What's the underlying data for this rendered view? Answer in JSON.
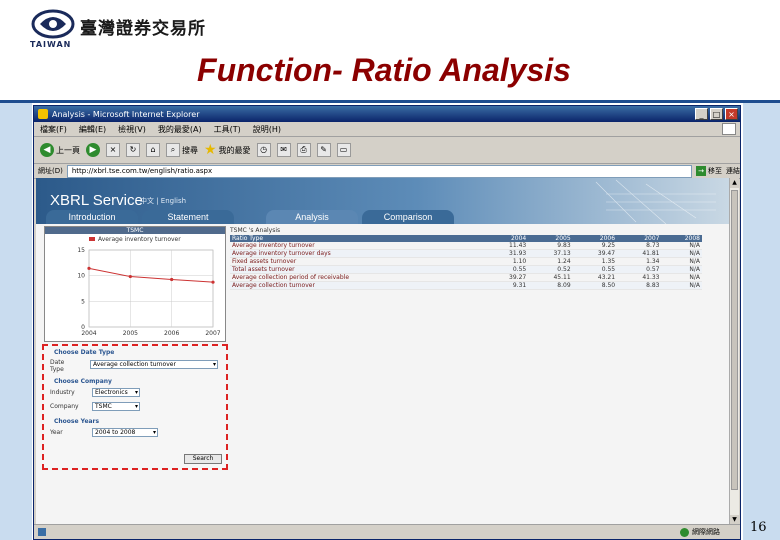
{
  "logo": {
    "org_name": "臺灣證券交易所",
    "tagline": "TAIWAN"
  },
  "slide": {
    "title": "Function- Ratio Analysis",
    "page_number": "16"
  },
  "browser": {
    "title": "Analysis - Microsoft Internet Explorer",
    "window_buttons": [
      "_",
      "□",
      "×"
    ],
    "menu": [
      "檔案(F)",
      "編輯(E)",
      "檢視(V)",
      "我的最愛(A)",
      "工具(T)",
      "說明(H)"
    ],
    "toolbar": {
      "back": "上一頁",
      "search": "搜尋",
      "favorites": "我的最愛"
    },
    "address_label": "網址(D)",
    "address": "http://xbrl.tse.com.tw/english/ratio.aspx",
    "go_label": "移至",
    "links_label": "連結",
    "status_zone": "網際網路"
  },
  "xbrl": {
    "brand": "XBRL Service",
    "langs": "中文 | English",
    "tabs": [
      "Introduction",
      "Statement",
      "Analysis",
      "Comparison"
    ],
    "active_tab": "Analysis"
  },
  "chart_data": {
    "type": "line",
    "title": "TSMC",
    "legend": "Average inventory turnover",
    "x": [
      "2004",
      "2005",
      "2006",
      "2007"
    ],
    "series": [
      {
        "name": "Average inventory turnover",
        "values": [
          11.43,
          9.83,
          9.25,
          8.73
        ]
      }
    ],
    "ylim": [
      0,
      15
    ],
    "yticks": [
      "15",
      "10",
      "5",
      "0"
    ],
    "grid": true
  },
  "table": {
    "caption": "TSMC 's Analysis",
    "headers": [
      "Ratio Type",
      "2004",
      "2005",
      "2006",
      "2007",
      "2008"
    ],
    "rows": [
      [
        "Average inventory turnover",
        "11.43",
        "9.83",
        "9.25",
        "8.73",
        "N/A"
      ],
      [
        "Average inventory turnover days",
        "31.93",
        "37.13",
        "39.47",
        "41.81",
        "N/A"
      ],
      [
        "Fixed assets turnover",
        "1.10",
        "1.24",
        "1.35",
        "1.34",
        "N/A"
      ],
      [
        "Total assets turnover",
        "0.55",
        "0.52",
        "0.55",
        "0.57",
        "N/A"
      ],
      [
        "Average collection period of receivable",
        "39.27",
        "45.11",
        "43.21",
        "41.33",
        "N/A"
      ],
      [
        "Average collection turnover",
        "9.31",
        "8.09",
        "8.50",
        "8.83",
        "N/A"
      ]
    ]
  },
  "form": {
    "date_type_header": "Choose Date Type",
    "date_type_label": "Date Type",
    "date_type_value": "Average collection turnover",
    "company_header": "Choose Company",
    "industry_label": "Industry",
    "industry_value": "Electronics",
    "company_label": "Company",
    "company_value": "TSMC",
    "years_header": "Choose Years",
    "year_label": "Year",
    "year_value": "2004 to 2008",
    "search_label": "Search"
  },
  "colors": {
    "title": "#8b0000",
    "frame": "#c9dcef",
    "header": "#2c5a8a",
    "highlight": "#dd2222"
  }
}
